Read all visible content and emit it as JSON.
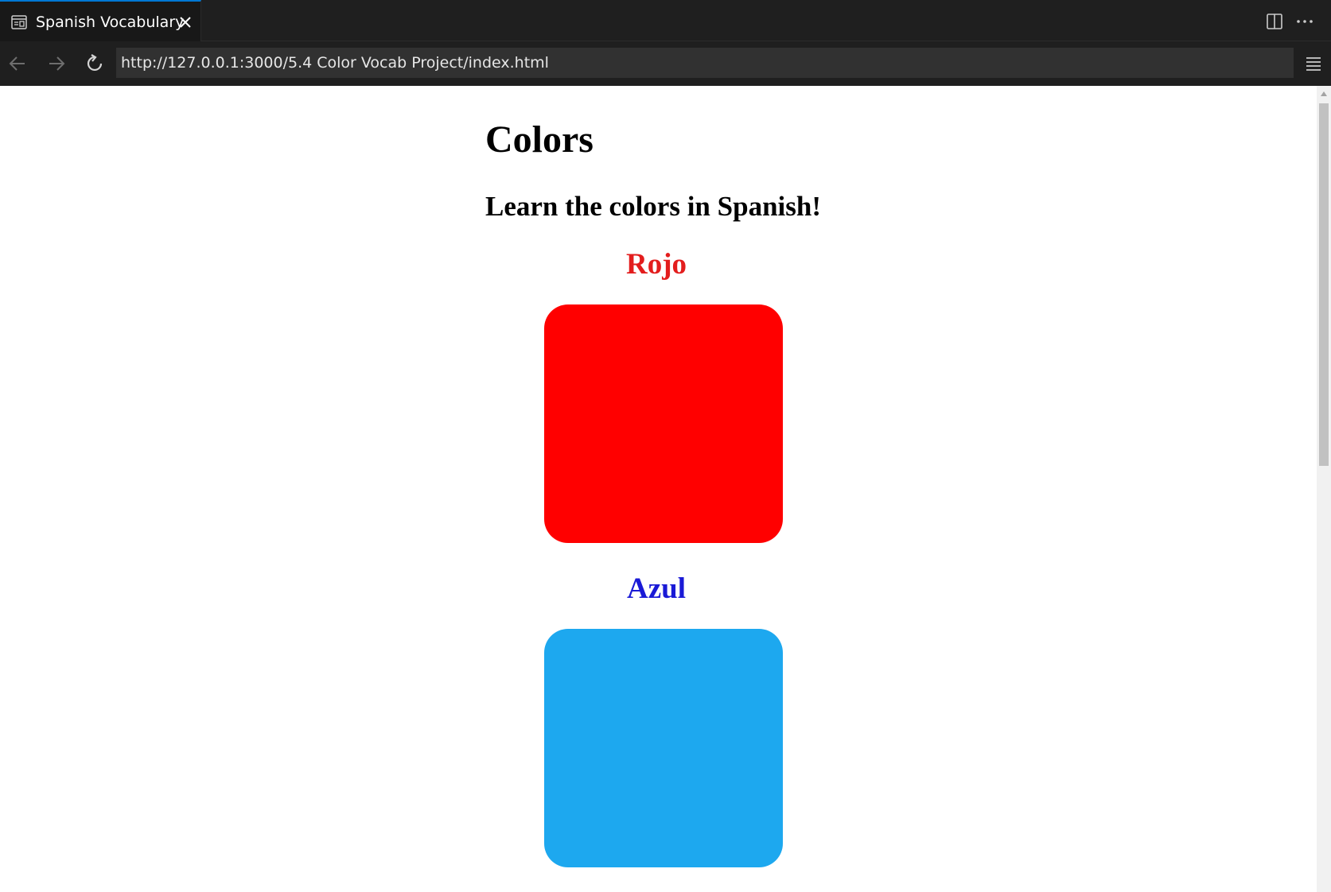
{
  "browser": {
    "tab_title": "Spanish Vocabulary",
    "url": "http://127.0.0.1:3000/5.4 Color Vocab Project/index.html",
    "icons": {
      "tab": "browser-page-icon",
      "close": "close-icon",
      "split": "split-editor-icon",
      "more": "more-actions-icon",
      "back": "back-arrow-icon",
      "forward": "forward-arrow-icon",
      "reload": "reload-icon",
      "menu": "hamburger-menu-icon"
    },
    "colors": {
      "chrome": "#1f1f1f",
      "active_tab": "#181818",
      "url_field": "#313131",
      "accent": "#0078d4"
    }
  },
  "page": {
    "title": "Colors",
    "subtitle": "Learn the colors in Spanish!",
    "colors": [
      {
        "label": "Rojo",
        "label_color": "#e31d1d",
        "swatch": "#ff0000"
      },
      {
        "label": "Azul",
        "label_color": "#1a1ad6",
        "swatch": "#1da8ef"
      }
    ]
  }
}
